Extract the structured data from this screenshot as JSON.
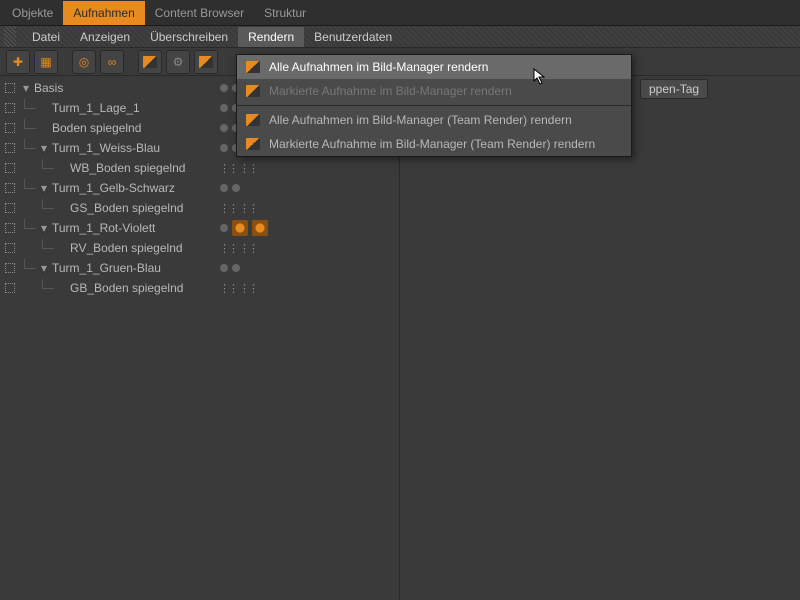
{
  "topTabs": [
    {
      "label": "Objekte",
      "active": false
    },
    {
      "label": "Aufnahmen",
      "active": true
    },
    {
      "label": "Content Browser",
      "active": false
    },
    {
      "label": "Struktur",
      "active": false
    }
  ],
  "menubar": [
    "Datei",
    "Anzeigen",
    "Überschreiben",
    "Rendern",
    "Benutzerdaten"
  ],
  "openMenu": "Rendern",
  "tagBar": {
    "visible_chip": "ppen-Tag"
  },
  "dropdown": [
    {
      "label": "Alle Aufnahmen im Bild-Manager rendern",
      "state": "highlight"
    },
    {
      "label": "Markierte Aufnahme im Bild-Manager rendern",
      "state": "disabled"
    },
    {
      "sep": true
    },
    {
      "label": "Alle Aufnahmen im Bild-Manager (Team Render) rendern",
      "state": "normal"
    },
    {
      "label": "Markierte Aufnahme im Bild-Manager (Team Render) rendern",
      "state": "normal"
    }
  ],
  "tree": [
    {
      "depth": 0,
      "label": "Basis",
      "expand": "down",
      "tags": [
        "dot",
        "dot"
      ]
    },
    {
      "depth": 1,
      "label": "Turm_1_Lage_1",
      "tags": [
        "dot",
        "dot"
      ]
    },
    {
      "depth": 1,
      "label": "Boden spiegelnd",
      "tags": [
        "dot",
        "dot"
      ]
    },
    {
      "depth": 1,
      "label": "Turm_1_Weiss-Blau",
      "expand": "down",
      "tags": [
        "dot",
        "dot"
      ]
    },
    {
      "depth": 2,
      "label": "WB_Boden spiegelnd",
      "tags": [
        "dots",
        "dots"
      ]
    },
    {
      "depth": 1,
      "label": "Turm_1_Gelb-Schwarz",
      "expand": "down",
      "tags": [
        "dot",
        "dot"
      ]
    },
    {
      "depth": 2,
      "label": "GS_Boden spiegelnd",
      "tags": [
        "dots",
        "dots"
      ]
    },
    {
      "depth": 1,
      "label": "Turm_1_Rot-Violett",
      "expand": "down",
      "tags": [
        "dot",
        "gear",
        "gear"
      ]
    },
    {
      "depth": 2,
      "label": "RV_Boden spiegelnd",
      "tags": [
        "dots",
        "dots"
      ]
    },
    {
      "depth": 1,
      "label": "Turm_1_Gruen-Blau",
      "expand": "down",
      "tags": [
        "dot",
        "dot"
      ]
    },
    {
      "depth": 2,
      "label": "GB_Boden spiegelnd",
      "tags": [
        "dots",
        "dots"
      ]
    }
  ],
  "colors": {
    "accent": "#e78a1f"
  }
}
